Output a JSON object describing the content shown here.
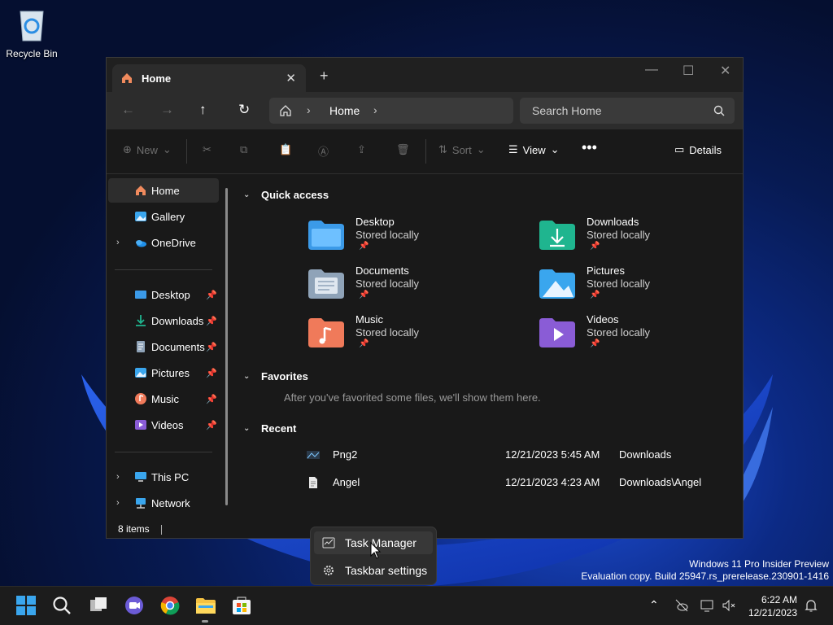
{
  "desktop": {
    "recycle_bin": "Recycle Bin",
    "watermark_line1": "Windows 11 Pro Insider Preview",
    "watermark_line2": "Evaluation copy. Build 25947.rs_prerelease.230901-1416"
  },
  "window": {
    "tab_title": "Home",
    "breadcrumb": "Home",
    "search_placeholder": "Search Home",
    "toolbar": {
      "new": "New",
      "sort": "Sort",
      "view": "View",
      "details": "Details"
    },
    "sidebar": {
      "top": [
        {
          "label": "Home",
          "icon": "home-icon"
        },
        {
          "label": "Gallery",
          "icon": "gallery-icon"
        },
        {
          "label": "OneDrive",
          "icon": "onedrive-icon"
        }
      ],
      "pinned": [
        {
          "label": "Desktop",
          "icon": "desktop-folder-icon"
        },
        {
          "label": "Downloads",
          "icon": "downloads-folder-icon"
        },
        {
          "label": "Documents",
          "icon": "documents-folder-icon"
        },
        {
          "label": "Pictures",
          "icon": "pictures-folder-icon"
        },
        {
          "label": "Music",
          "icon": "music-folder-icon"
        },
        {
          "label": "Videos",
          "icon": "videos-folder-icon"
        }
      ],
      "bottom": [
        {
          "label": "This PC",
          "icon": "this-pc-icon"
        },
        {
          "label": "Network",
          "icon": "network-icon"
        }
      ]
    },
    "sections": {
      "quick_access": "Quick access",
      "favorites": "Favorites",
      "recent": "Recent"
    },
    "quick_access": [
      {
        "name": "Desktop",
        "sub": "Stored locally",
        "color": "#3b9ae8"
      },
      {
        "name": "Downloads",
        "sub": "Stored locally",
        "color": "#1fb58f"
      },
      {
        "name": "Documents",
        "sub": "Stored locally",
        "color": "#8fa3b8"
      },
      {
        "name": "Pictures",
        "sub": "Stored locally",
        "color": "#3aa6ee"
      },
      {
        "name": "Music",
        "sub": "Stored locally",
        "color": "#f07a5a"
      },
      {
        "name": "Videos",
        "sub": "Stored locally",
        "color": "#8a5cd6"
      }
    ],
    "favorites_empty": "After you've favorited some files, we'll show them here.",
    "recent": [
      {
        "name": "Png2",
        "date": "12/21/2023 5:45 AM",
        "location": "Downloads"
      },
      {
        "name": "Angel",
        "date": "12/21/2023 4:23 AM",
        "location": "Downloads\\Angel"
      }
    ],
    "status": "8 items"
  },
  "context_menu": {
    "task_manager": "Task Manager",
    "taskbar_settings": "Taskbar settings"
  },
  "taskbar": {
    "time": "6:22 AM",
    "date": "12/21/2023"
  }
}
